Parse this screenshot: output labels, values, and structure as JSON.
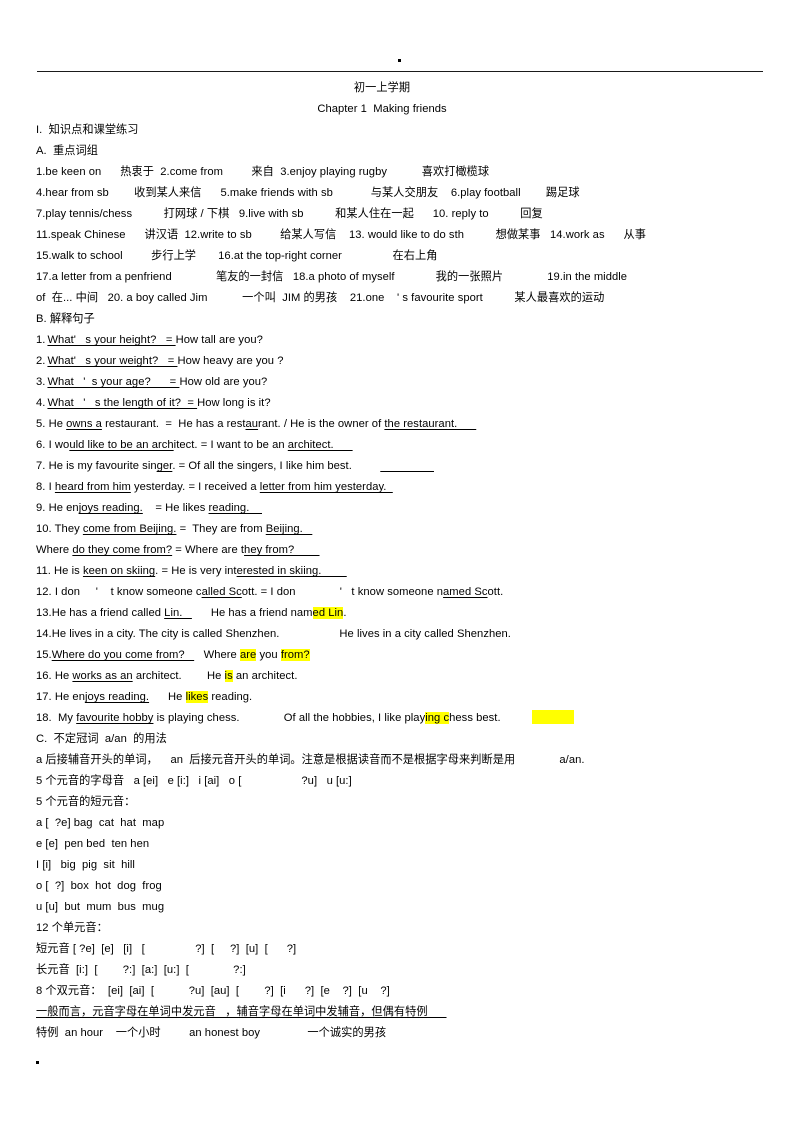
{
  "document": {
    "title": "初一上学期",
    "chapter": "Chapter 1  Making friends",
    "section_1": "I.  知识点和课堂练习",
    "section_A": "A.  重点词组",
    "section_B": "B. 解释句子",
    "section_C": "C.  不定冠词  a/an  的用法"
  },
  "vocabulary_lines": [
    "1.be keen on      热衷于  2.come from         来自  3.enjoy playing rugby           喜欢打橄榄球",
    "4.hear from sb        收到某人来信      5.make friends with sb            与某人交朋友    6.play football        踢足球",
    "7.play tennis/chess          打网球 / 下棋   9.live with sb          和某人住在一起      10. reply to          回复",
    "11.speak Chinese      讲汉语  12.write to sb         给某人写信    13. would like to do sth          想做某事   14.work as      从事",
    "15.walk to school         步行上学       16.at the top-right corner                在右上角",
    "17.a letter from a penfriend              笔友的一封信   18.a photo of myself             我的一张照片              19.in the middle",
    "of  在... 中间   20. a boy called Jim           一个叫  JIM 的男孩    21.one    ' s favourite sport          某人最喜欢的运动"
  ],
  "sentences": {
    "s1_num": "1.",
    "s1_a": "What'   s your height?   = ",
    "s1_b": "How tall are you?",
    "s2_num": "2.",
    "s2_a": "What'   s your weight?   = ",
    "s2_b": "How heavy are you ?",
    "s3_num": "3.",
    "s3_a": "What   '  s your age?      = ",
    "s3_b": "How old are you?",
    "s4_num": "4.",
    "s4_a": "What   '   s the length of it?  = ",
    "s4_b": "How long is it?",
    "s5_pre": "5. He ",
    "s5_u1": "owns a",
    "s5_mid": " restaurant.  =  He has a rest",
    "s5_u2": "au",
    "s5_mid2": "rant. / He is the owner of ",
    "s5_u3": "the restaurant.      ",
    "s6_pre": "6. I wo",
    "s6_u1": "uld like to be an arch",
    "s6_mid": "itect. = I want to be an ",
    "s6_u2": "architect.      ",
    "s7_pre": "7. He is my favourite sin",
    "s7_u1": "ger",
    "s7_mid": ". = Of all the singers, I like him best.         ",
    "s7_blank": "                 ",
    "s8_pre": "8. I ",
    "s8_u1": "heard from him",
    "s8_mid": " yesterday. = I received a ",
    "s8_u2": "letter from him yesterday.  ",
    "s9_pre": "9. He en",
    "s9_u1": "joys reading.",
    "s9_mid": "    = He likes ",
    "s9_u2": "reading.    ",
    "s10_pre": "10. They ",
    "s10_u1": "come from Beijing.",
    "s10_mid": " =  They are from ",
    "s10_u2": "Beijing.   ",
    "s10b_pre": "Where ",
    "s10b_u1": "do they come from?",
    "s10b_mid": " = Where are t",
    "s10b_u2": "hey from?        ",
    "s11_pre": "11. He is ",
    "s11_u1": "keen on skiing",
    "s11_mid": ". = He is very int",
    "s11_u2": "erested in skiing.        ",
    "s12_pre": "12. I don     '    t know someone c",
    "s12_u1": "alled Sc",
    "s12_mid": "ott. = I don              '   t know someone n",
    "s12_u2": "amed Sc",
    "s12_end": "ott.",
    "s13_pre": "13.He has a friend called ",
    "s13_u1": "Lin.   ",
    "s13_mid": "      He has a friend nam",
    "s13_hl": "ed Lin",
    "s13_end": ".",
    "s14": "14.He lives in a city. The city is called Shenzhen.                   He lives in a city called Shenzhen.",
    "s15_pre": "15.",
    "s15_u1": "Where do you come from?   ",
    "s15_mid": "   Where ",
    "s15_hl1": "are",
    "s15_mid2": " you ",
    "s15_hl2": "from?",
    "s16_pre": "16. He ",
    "s16_u1": "works as an",
    "s16_mid": " architect.        He ",
    "s16_hl": "is",
    "s16_end": " an architect.",
    "s17_pre": "17. He en",
    "s17_u1": "joys reading.",
    "s17_mid": "      He ",
    "s17_hl": "likes",
    "s17_end": " reading.",
    "s18_pre": "18.  My ",
    "s18_u1": "favourite hobby",
    "s18_mid": " is playing chess.              Of all the hobbies, I like play",
    "s18_hl": "ing c",
    "s18_end": "hess best."
  },
  "articles": {
    "rule": "a 后接辅音开头的单词，    an  后接元音开头的单词。注意是根据读音而不是根据字母来判断是用              a/an.",
    "letter_sounds": "5 个元音的字母音   a [ei]   e [i:]   i [ai]   o [                   ?u]   u [u:]",
    "short_vowels_title": "5 个元音的短元音：",
    "v_a": "a [  ?e] bag  cat  hat  map",
    "v_e": "e [e]  pen bed  ten hen",
    "v_i": "I [i]   big  pig  sit  hill",
    "v_o": "o [  ?]  box  hot  dog  frog",
    "v_u": "u [u]  but  mum  bus  mug",
    "monophthongs_title": "12 个单元音：",
    "short_row": "短元音 [ ?e]  [e]   [i]   [                ?]  [     ?]  [u]  [      ?]",
    "long_row": "长元音  [i:]  [        ?:]  [a:]  [u:]  [              ?:]",
    "diphthongs_row": "8 个双元音：  [ei]  [ai]  [           ?u]  [au]  [        ?]  [i      ?]  [e    ?]  [u    ?]",
    "general_rule": "一般而言，元音字母在单词中发元音   ，辅音字母在单词中发辅音，但偶有特例      ",
    "exception": "特例  an hour    一个小时         an honest boy               一个诚实的男孩"
  }
}
